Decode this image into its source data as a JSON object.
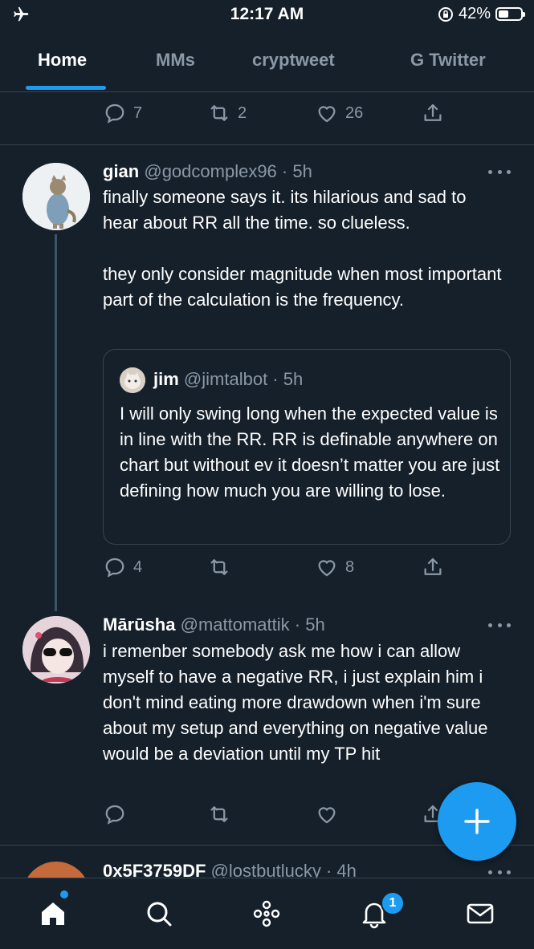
{
  "status_bar": {
    "time": "12:17 AM",
    "battery": "42%",
    "battery_level": 0.42
  },
  "tabs": [
    {
      "label": "Home",
      "active": true
    },
    {
      "label": "MMs"
    },
    {
      "label": "cryptweet"
    },
    {
      "label": "G Twitter"
    }
  ],
  "prev_actions": {
    "replies": "7",
    "retweets": "2",
    "likes": "26"
  },
  "tweet1": {
    "name": "gian",
    "handle": "@godcomplex96",
    "time": "5h",
    "text_p1": "finally someone says it. its hilarious and sad to hear about RR all the time. so clueless.",
    "text_p2": "they only consider magnitude when most important part of the calculation is the frequency.",
    "quote": {
      "name": "jim",
      "handle": "@jimtalbot",
      "time": "5h",
      "text": "I will only swing long when the expected value is in line with the RR. RR is definable anywhere on chart but without ev it doesn’t matter you are just defining how much you are willing to lose."
    },
    "actions": {
      "replies": "4",
      "likes": "8"
    }
  },
  "tweet2": {
    "name": "Mārūsha",
    "handle": "@mattomattik",
    "time": "5h",
    "text": "i remenber somebody ask me how i can allow myself to have a negative RR, i just explain him i don't mind eating more drawdown when i'm sure about my setup and everything on negative value would be a deviation until my TP hit"
  },
  "tweet3": {
    "name": "0x5F3759DF",
    "handle": "@lostbutlucky",
    "time": "4h"
  },
  "bottom_nav": {
    "notifications_badge": "1"
  },
  "colors": {
    "background": "#15202b",
    "accent": "#1d9bf0",
    "muted": "#8b98a5",
    "border": "#38444d"
  },
  "icons": [
    "airplane-icon",
    "orientation-lock-icon",
    "reply-icon",
    "retweet-icon",
    "like-icon",
    "share-icon",
    "more-icon",
    "compose-icon",
    "home-icon",
    "search-icon",
    "spaces-icon",
    "notifications-icon",
    "messages-icon"
  ]
}
